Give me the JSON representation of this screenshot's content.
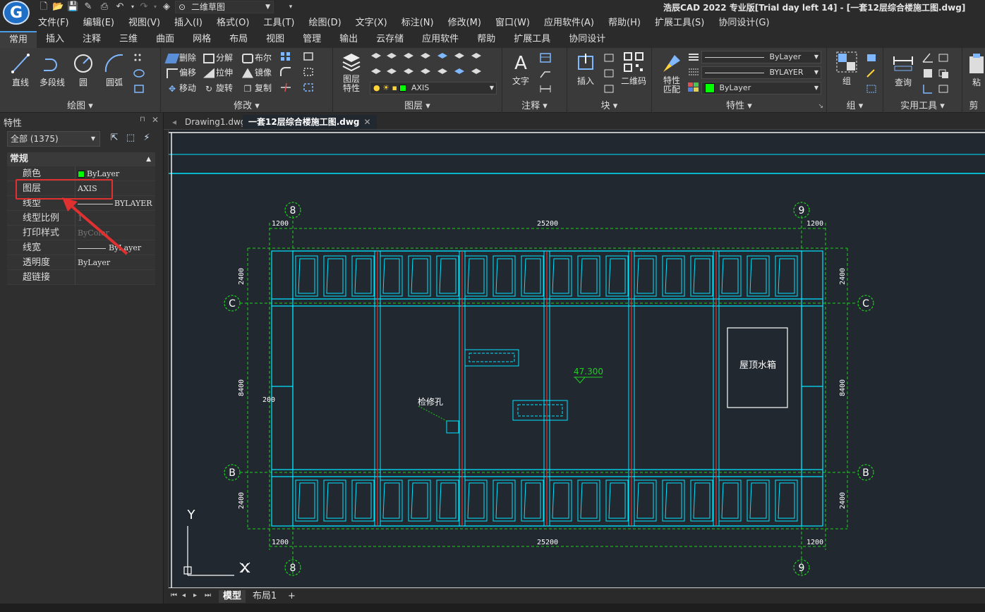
{
  "app": {
    "logo_letter": "G",
    "workspace": "二维草图",
    "title": "浩辰CAD 2022 专业版[Trial day left 14] - [一套12层综合楼施工图.dwg]"
  },
  "menubar": [
    "文件(F)",
    "编辑(E)",
    "视图(V)",
    "插入(I)",
    "格式(O)",
    "工具(T)",
    "绘图(D)",
    "文字(X)",
    "标注(N)",
    "修改(M)",
    "窗口(W)",
    "应用软件(A)",
    "帮助(H)",
    "扩展工具(S)",
    "协同设计(G)"
  ],
  "ribbon_tabs": [
    "常用",
    "插入",
    "注释",
    "三维",
    "曲面",
    "网格",
    "布局",
    "视图",
    "管理",
    "输出",
    "云存储",
    "应用软件",
    "帮助",
    "扩展工具",
    "协同设计"
  ],
  "ribbon": {
    "draw": {
      "title": "绘图",
      "line": "直线",
      "polyline": "多段线",
      "circle": "圆",
      "arc": "圆弧"
    },
    "modify": {
      "title": "修改",
      "delete": "删除",
      "explode": "分解",
      "boolean": "布尔",
      "offset": "偏移",
      "stretch": "拉伸",
      "mirror": "镜像",
      "move": "移动",
      "rotate": "旋转",
      "copy": "复制"
    },
    "layer": {
      "title": "图层",
      "props_label": "图层特性",
      "current_layer": "AXIS"
    },
    "annotate": {
      "title": "注释",
      "text": "文字"
    },
    "block": {
      "title": "块",
      "insert": "插入",
      "qrcode": "二维码"
    },
    "properties": {
      "title": "特性",
      "match": "特性匹配",
      "color": "ByLayer",
      "linetype": "ByLayer",
      "lineweight": "BYLAYER",
      "color2": "ByLayer"
    },
    "group": {
      "title": "组",
      "group": "组"
    },
    "utilities": {
      "title": "实用工具",
      "query": "查询"
    },
    "clipboard": {
      "title": "剪",
      "paste": "粘"
    }
  },
  "properties_palette": {
    "title": "特性",
    "filter": "全部 (1375)",
    "section": "常规",
    "rows": [
      {
        "name": "颜色",
        "value": "ByLayer"
      },
      {
        "name": "图层",
        "value": "AXIS"
      },
      {
        "name": "线型",
        "value": "BYLAYER"
      },
      {
        "name": "线型比例",
        "value": "1"
      },
      {
        "name": "打印样式",
        "value": "ByColor"
      },
      {
        "name": "线宽",
        "value": "ByLayer"
      },
      {
        "name": "透明度",
        "value": "ByLayer"
      },
      {
        "name": "超链接",
        "value": ""
      }
    ]
  },
  "doc_tabs": [
    "Drawing1.dwg",
    "一套12层综合楼施工图.dwg"
  ],
  "layout_tabs": [
    "模型",
    "布局1",
    "+"
  ],
  "drawing": {
    "axis_top_left": "8",
    "axis_top_right": "9",
    "axis_left_c": "C",
    "axis_right_c": "C",
    "axis_left_b": "B",
    "axis_right_b": "B",
    "axis_bottom_left": "8",
    "axis_bottom_right": "9",
    "dim_top_left": "1200",
    "dim_top_mid": "25200",
    "dim_top_right": "1200",
    "dim_bottom_left": "1200",
    "dim_bottom_mid": "25200",
    "dim_bottom_right": "1200",
    "dim_left_top": "2400",
    "dim_left_mid": "8400",
    "dim_left_bottom": "2400",
    "dim_right_top": "2400",
    "dim_right_mid": "8400",
    "dim_right_bottom": "2400",
    "dim_200": "200",
    "label_tank": "屋顶水箱",
    "label_hatch": "检修孔",
    "elevation": "47.300",
    "ucs_y": "Y",
    "ucs_x": "X"
  }
}
